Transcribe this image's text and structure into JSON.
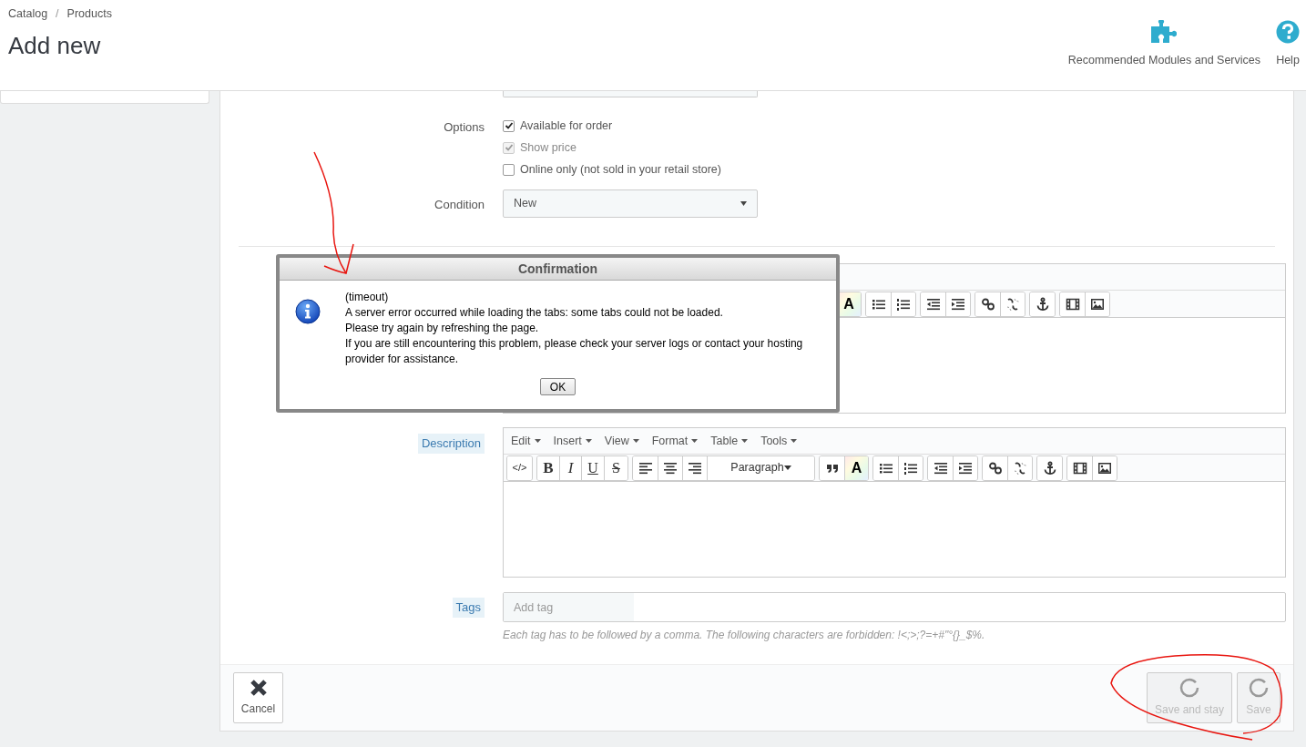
{
  "header": {
    "breadcrumb": [
      "Catalog",
      "Products"
    ],
    "breadcrumb_separator": "/",
    "title": "Add new",
    "actions": [
      {
        "kind": "modules",
        "label": "Recommended Modules and Services"
      },
      {
        "kind": "help",
        "label": "Help"
      }
    ]
  },
  "form": {
    "options_label": "Options",
    "options": [
      {
        "label": "Available for order",
        "checked": true,
        "disabled": false
      },
      {
        "label": "Show price",
        "checked": true,
        "disabled": true
      },
      {
        "label": "Online only (not sold in your retail store)",
        "checked": false,
        "disabled": false
      }
    ],
    "condition_label": "Condition",
    "condition_value": "New",
    "editors": [
      {
        "toolbar": [
          [
            {
              "kind": "color",
              "label": "A"
            }
          ],
          [
            {
              "kind": "ul"
            },
            {
              "kind": "ol"
            }
          ],
          [
            {
              "kind": "outdent"
            },
            {
              "kind": "indent"
            }
          ],
          [
            {
              "kind": "link"
            },
            {
              "kind": "unlink"
            }
          ],
          [
            {
              "kind": "anchor"
            }
          ],
          [
            {
              "kind": "media"
            },
            {
              "kind": "image"
            }
          ]
        ]
      },
      {
        "label": "Description",
        "menu": [
          "Edit",
          "Insert",
          "View",
          "Format",
          "Table",
          "Tools"
        ],
        "toolbar": [
          [
            {
              "kind": "code",
              "label": "</>"
            }
          ],
          [
            {
              "kind": "bold",
              "label": "B"
            },
            {
              "kind": "italic",
              "label": "I"
            },
            {
              "kind": "underline",
              "label": "U"
            },
            {
              "kind": "strike",
              "label": "S"
            }
          ],
          [
            {
              "kind": "left"
            },
            {
              "kind": "center"
            },
            {
              "kind": "right"
            },
            {
              "kind": "select",
              "label": "Paragraph"
            }
          ],
          [
            {
              "kind": "quote"
            },
            {
              "kind": "color",
              "label": "A"
            }
          ],
          [
            {
              "kind": "ul"
            },
            {
              "kind": "ol"
            }
          ],
          [
            {
              "kind": "outdent"
            },
            {
              "kind": "indent"
            }
          ],
          [
            {
              "kind": "link"
            },
            {
              "kind": "unlink"
            }
          ],
          [
            {
              "kind": "anchor"
            }
          ],
          [
            {
              "kind": "media"
            },
            {
              "kind": "image"
            }
          ]
        ]
      }
    ],
    "tags_label": "Tags",
    "tags_placeholder": "Add tag",
    "tags_help": "Each tag has to be followed by a comma. The following characters are forbidden: !<;>;?=+#\"°{}_$%."
  },
  "footer": {
    "buttons": [
      {
        "kind": "cancel",
        "label": "Cancel",
        "disabled": false
      },
      {
        "kind": "save_stay",
        "label": "Save and stay",
        "disabled": true
      },
      {
        "kind": "save",
        "label": "Save",
        "disabled": true
      }
    ]
  },
  "dialog": {
    "title": "Confirmation",
    "lines": [
      "(timeout)",
      "A server error occurred while loading the tabs: some tabs could not be loaded.",
      "Please try again by refreshing the page.",
      "If you are still encountering this problem, please check your server logs or contact your hosting provider for assistance."
    ],
    "button": "OK"
  }
}
